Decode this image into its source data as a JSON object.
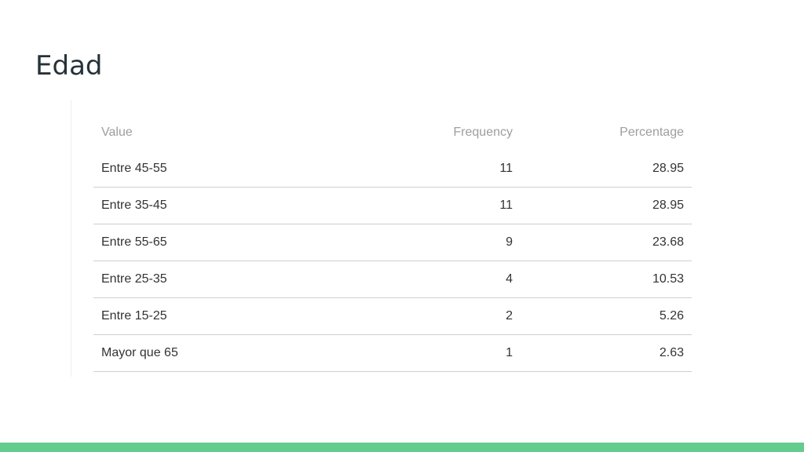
{
  "slide": {
    "title": "Edad"
  },
  "table": {
    "headers": {
      "value": "Value",
      "frequency": "Frequency",
      "percentage": "Percentage"
    },
    "rows": [
      {
        "value": "Entre 45-55",
        "frequency": "11",
        "percentage": "28.95"
      },
      {
        "value": "Entre 35-45",
        "frequency": "11",
        "percentage": "28.95"
      },
      {
        "value": "Entre 55-65",
        "frequency": "9",
        "percentage": "23.68"
      },
      {
        "value": "Entre 25-35",
        "frequency": "4",
        "percentage": "10.53"
      },
      {
        "value": "Entre 15-25",
        "frequency": "2",
        "percentage": "5.26"
      },
      {
        "value": "Mayor que 65",
        "frequency": "1",
        "percentage": "2.63"
      }
    ]
  },
  "theme": {
    "accent_bar_color": "#64cc8c"
  }
}
